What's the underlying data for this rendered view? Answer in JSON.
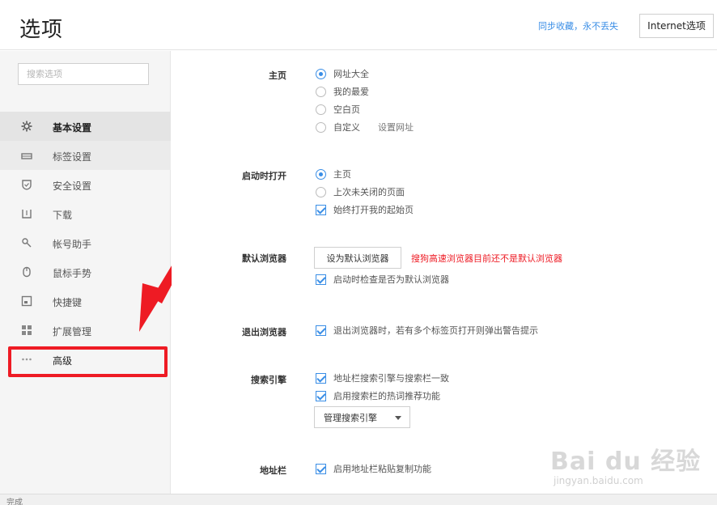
{
  "header": {
    "title": "选项",
    "sync_link": "同步收藏，永不丢失",
    "internet_button": "Internet选项"
  },
  "sidebar": {
    "search_placeholder": "搜索选项",
    "items": [
      {
        "label": "基本设置",
        "icon": "gear-icon"
      },
      {
        "label": "标签设置",
        "icon": "tab-icon"
      },
      {
        "label": "安全设置",
        "icon": "shield-icon"
      },
      {
        "label": "下载",
        "icon": "download-icon"
      },
      {
        "label": "帐号助手",
        "icon": "key-icon"
      },
      {
        "label": "鼠标手势",
        "icon": "mouse-icon"
      },
      {
        "label": "快捷键",
        "icon": "keyboard-icon"
      },
      {
        "label": "扩展管理",
        "icon": "grid-icon"
      },
      {
        "label": "高级",
        "icon": "more-dots-icon"
      }
    ]
  },
  "main": {
    "homepage": {
      "label": "主页",
      "options": [
        "网址大全",
        "我的最爱",
        "空白页",
        "自定义"
      ],
      "selected": "网址大全",
      "custom_link": "设置网址"
    },
    "startup": {
      "label": "启动时打开",
      "options": [
        "主页",
        "上次未关闭的页面"
      ],
      "selected": "主页",
      "checkbox": "始终打开我的起始页"
    },
    "default_browser": {
      "label": "默认浏览器",
      "button": "设为默认浏览器",
      "warning": "搜狗高速浏览器目前还不是默认浏览器",
      "checkbox": "启动时检查是否为默认浏览器"
    },
    "exit_browser": {
      "label": "退出浏览器",
      "checkbox": "退出浏览器时，若有多个标签页打开则弹出警告提示"
    },
    "search_engine": {
      "label": "搜索引擎",
      "checkboxes": [
        "地址栏搜索引擎与搜索栏一致",
        "启用搜索栏的热词推荐功能"
      ],
      "dropdown": "管理搜索引擎"
    },
    "address_bar": {
      "label": "地址栏",
      "checkbox": "启用地址栏粘贴复制功能"
    }
  },
  "status_bar": {
    "text": "完成"
  },
  "watermark": {
    "text": "Bai du 经验",
    "sub": "jingyan.baidu.com"
  },
  "colors": {
    "accent": "#3a8ee6",
    "warning": "#ee1b24",
    "annotation": "#ee1b24"
  }
}
